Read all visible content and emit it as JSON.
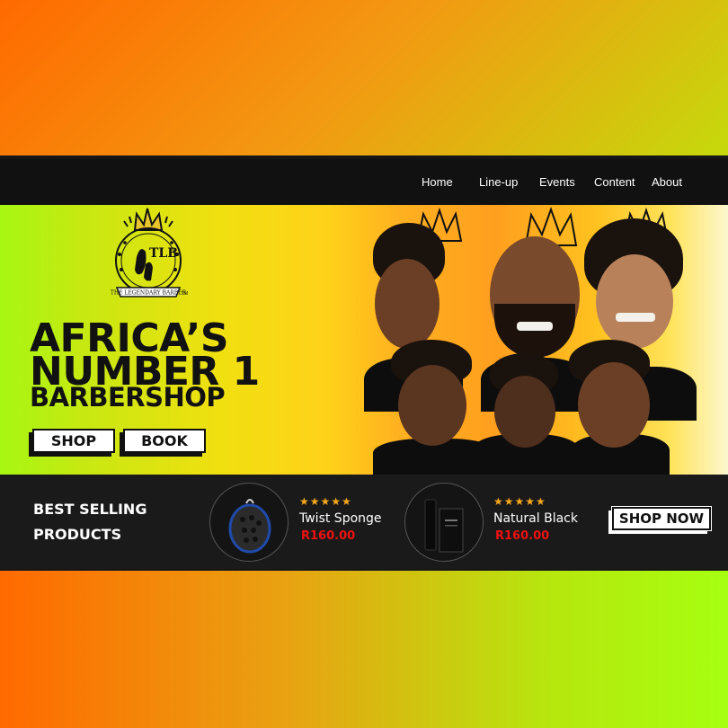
{
  "nav": {
    "items": [
      "Home",
      "Line-up",
      "Events",
      "Content",
      "About"
    ]
  },
  "logo": {
    "monogram": "TLB",
    "ribbon": "THE LEGENDARY BARBER",
    "tm": "TM"
  },
  "hero": {
    "line1": "AFRICA’S",
    "line2": "NUMBER 1",
    "line3": "BARBERSHOP",
    "shop_label": "SHOP",
    "book_label": "BOOK",
    "image": "group-of-customers-with-crowns-photo"
  },
  "products": {
    "title_line1": "BEST SELLING",
    "title_line2": "PRODUCTS",
    "items": [
      {
        "name": "Twist Sponge",
        "price": "R160.00",
        "stars": "★★★★★",
        "image": "twist-sponge-photo"
      },
      {
        "name": "Natural Black",
        "price": "R160.00",
        "stars": "★★★★★",
        "image": "natural-black-product-photo"
      }
    ],
    "shop_now_label": "SHOP NOW"
  },
  "colors": {
    "bar": "#111111",
    "accent_star": "#f7a81b",
    "price": "#ee1111",
    "gradient_orange": "#ff6a00",
    "gradient_green": "#a6ff10"
  }
}
